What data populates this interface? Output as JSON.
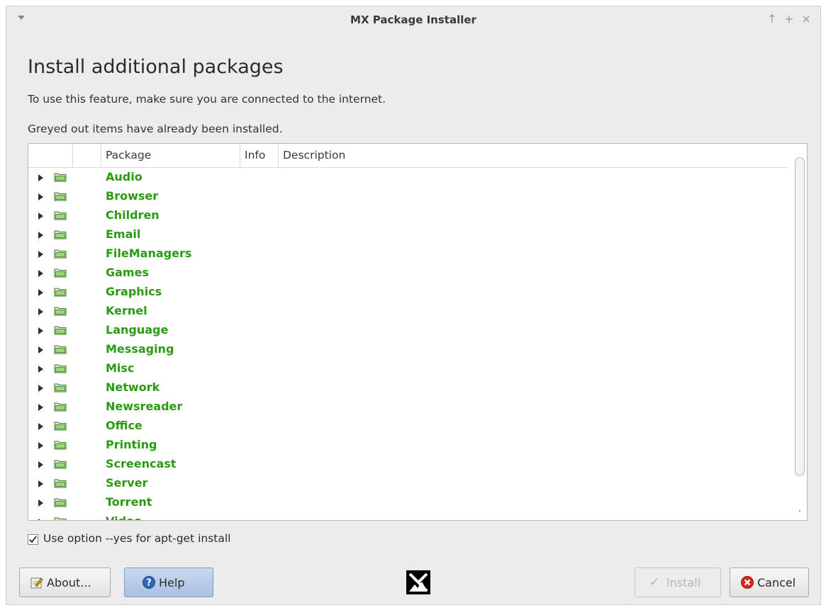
{
  "window": {
    "title": "MX Package Installer"
  },
  "titlebar": {
    "menu_icon": "chevron-down-icon",
    "buttons": [
      "↑",
      "+",
      "×"
    ]
  },
  "page": {
    "heading": "Install additional packages",
    "notice1": "To use this feature, make sure you are connected to the internet.",
    "notice2": "Greyed out items have already been installed."
  },
  "tree": {
    "columns": {
      "package": "Package",
      "info": "Info",
      "description": "Description"
    },
    "categories": [
      "Audio",
      "Browser",
      "Children",
      "Email",
      "FileManagers",
      "Games",
      "Graphics",
      "Kernel",
      "Language",
      "Messaging",
      "Misc",
      "Network",
      "Newsreader",
      "Office",
      "Printing",
      "Screencast",
      "Server",
      "Torrent",
      "Video"
    ],
    "category_color": "#2a9a12"
  },
  "options": {
    "yes_label": "Use option --yes for apt-get install",
    "yes_checked": true
  },
  "buttons": {
    "about": "About...",
    "help": "Help",
    "install": "Install",
    "cancel": "Cancel"
  }
}
